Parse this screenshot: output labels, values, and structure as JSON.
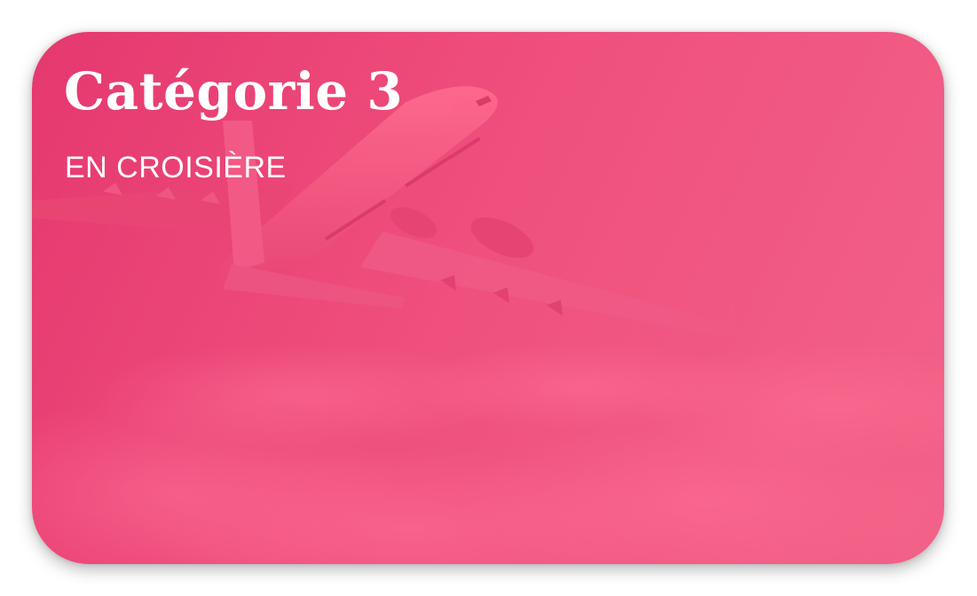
{
  "card": {
    "title": "Catégorie 3",
    "subtitle": "EN CROISIÈRE",
    "background_image": "airplane-above-clouds",
    "overlay_color": "#ec4a78"
  }
}
